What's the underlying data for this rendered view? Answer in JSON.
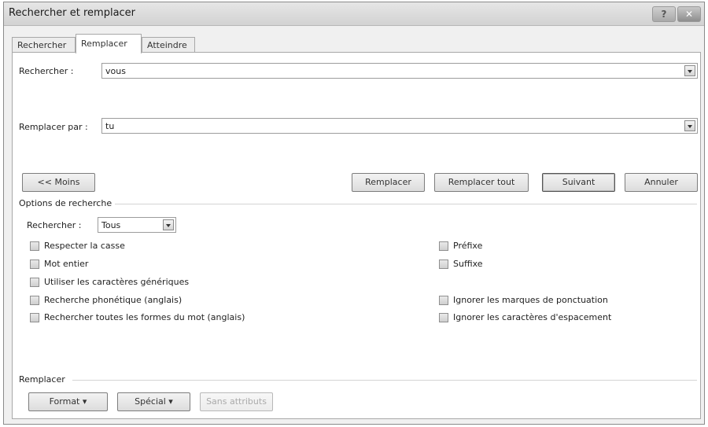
{
  "window": {
    "title": "Rechercher et remplacer",
    "help_label": "?",
    "close_label": "✕"
  },
  "tabs": [
    {
      "label": "Rechercher",
      "active": false
    },
    {
      "label": "Remplacer",
      "active": true
    },
    {
      "label": "Atteindre",
      "active": false
    }
  ],
  "find": {
    "label": "Rechercher :",
    "value": "vous"
  },
  "replace": {
    "label": "Remplacer par :",
    "value": "tu"
  },
  "buttons": {
    "less": "<< Moins",
    "replace": "Remplacer",
    "replace_all": "Remplacer tout",
    "next": "Suivant",
    "cancel": "Annuler"
  },
  "options": {
    "section_title": "Options de recherche",
    "search_label": "Rechercher :",
    "search_value": "Tous",
    "left_checks": [
      {
        "label": "Respecter la casse",
        "checked": false
      },
      {
        "label": "Mot entier",
        "checked": false
      },
      {
        "label": "Utiliser les caractères génériques",
        "checked": false
      },
      {
        "label": "Recherche phonétique (anglais)",
        "checked": false
      },
      {
        "label": "Rechercher toutes les formes du mot (anglais)",
        "checked": false
      }
    ],
    "right_checks": [
      {
        "label": "Préfixe",
        "checked": false
      },
      {
        "label": "Suffixe",
        "checked": false
      },
      {
        "label": "Ignorer les marques de ponctuation",
        "checked": false
      },
      {
        "label": "Ignorer les caractères d'espacement",
        "checked": false
      }
    ]
  },
  "replace_section": {
    "title": "Remplacer",
    "format": "Format ▾",
    "special": "Spécial ▾",
    "no_attributes": "Sans attributs"
  }
}
